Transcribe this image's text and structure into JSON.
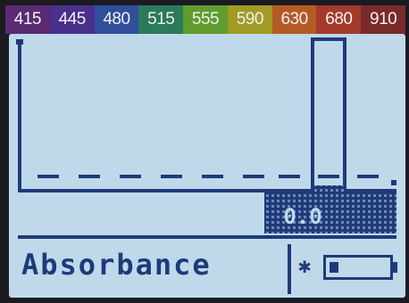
{
  "bands": [
    {
      "label": "415",
      "color": "#5a2a73"
    },
    {
      "label": "445",
      "color": "#4b2f8c"
    },
    {
      "label": "480",
      "color": "#2f4f9c"
    },
    {
      "label": "515",
      "color": "#2b7a5a"
    },
    {
      "label": "555",
      "color": "#5f9c2c"
    },
    {
      "label": "590",
      "color": "#a19a23"
    },
    {
      "label": "630",
      "color": "#b45a24"
    },
    {
      "label": "680",
      "color": "#a33a2a"
    },
    {
      "label": "910",
      "color": "#7a2a2a"
    }
  ],
  "display": {
    "readout_value": "0.0",
    "status_label": "Absorbance",
    "battery_fraction": 0.15
  },
  "colors": {
    "lcd_bg": "#bfd9ea",
    "lcd_ink": "#1f3a7a"
  },
  "icons": {
    "bluetooth": "bluetooth-icon",
    "battery": "battery-icon"
  }
}
